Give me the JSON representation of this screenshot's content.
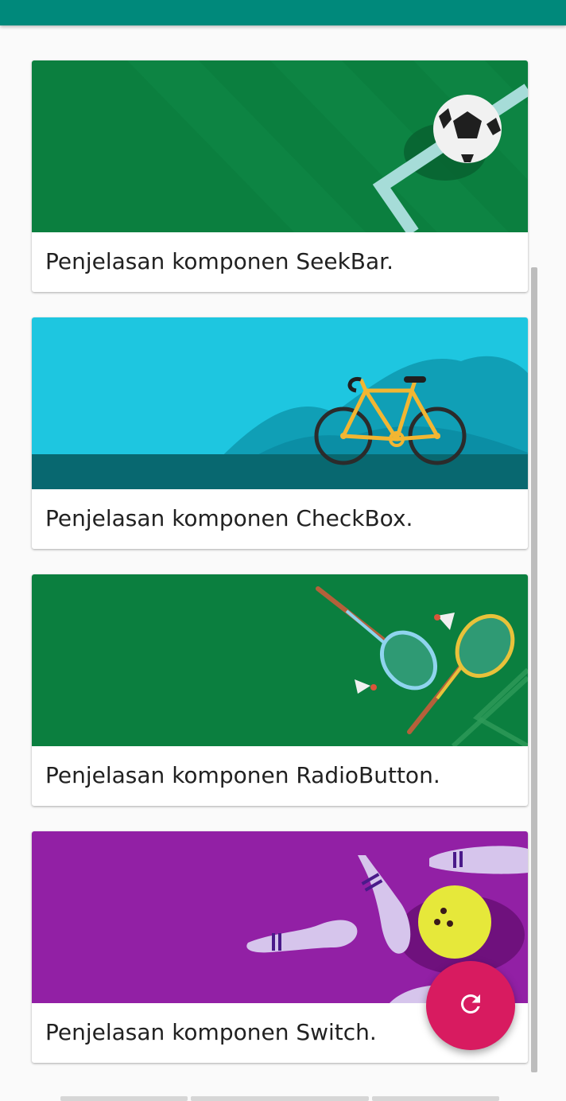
{
  "cards": [
    {
      "title": "SeekBar",
      "description": "Penjelasan komponen SeekBar."
    },
    {
      "title": "CheckBox",
      "description": "Penjelasan komponen CheckBox."
    },
    {
      "title": "RadioButton",
      "description": "Penjelasan komponen RadioButton."
    },
    {
      "title": "Switch",
      "description": "Penjelasan komponen Switch."
    }
  ],
  "fab": {
    "icon": "refresh-icon"
  },
  "colors": {
    "appbar": "#00897b",
    "fab": "#d81b60",
    "seekbar_bg": "#0b7f3f",
    "checkbox_bg": "#1ec6e0",
    "radiobutton_bg": "#0b7f3f",
    "switch_bg": "#9220a5"
  }
}
